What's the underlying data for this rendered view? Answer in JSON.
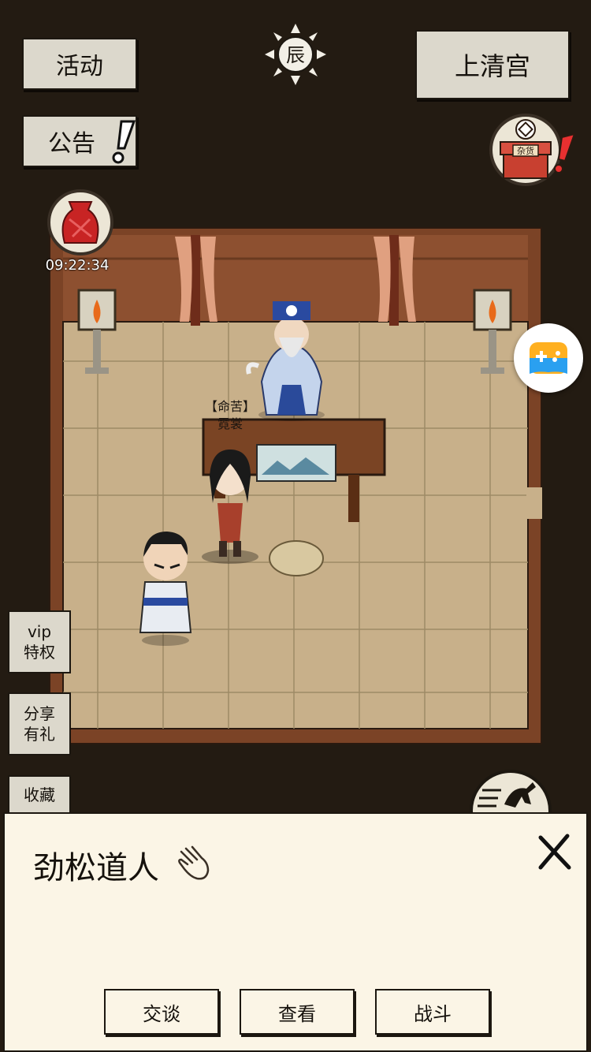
{
  "top": {
    "activity_label": "活动",
    "notice_label": "公告",
    "location_label": "上清宫",
    "time_char": "辰",
    "shop_sign": "杂货"
  },
  "timer": "09:22:34",
  "npc_label": {
    "title": "【命苦】",
    "name": "霓裳"
  },
  "side": {
    "vip_line1": "vip",
    "vip_line2": "特权",
    "share_line1": "分享",
    "share_line2": "有礼",
    "fav_label": "收藏"
  },
  "dialog": {
    "npc_name": "劲松道人",
    "talk_label": "交谈",
    "view_label": "查看",
    "fight_label": "战斗"
  },
  "colors": {
    "background": "#231b12",
    "paper": "#dcd8cc",
    "panel": "#fbf5e6",
    "floor": "#c9b28a",
    "wall": "#8a4b2c"
  }
}
